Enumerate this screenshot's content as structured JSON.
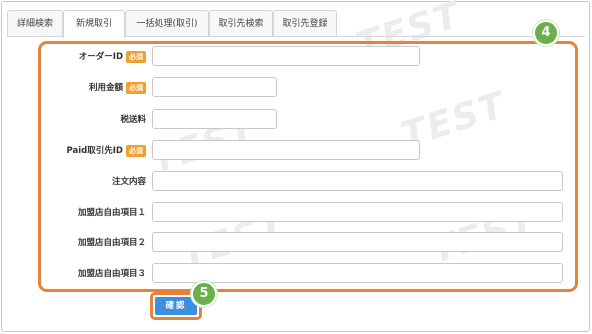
{
  "tabs": [
    {
      "label": "詳細検索"
    },
    {
      "label": "新規取引"
    },
    {
      "label": "一括処理(取引)"
    },
    {
      "label": "取引先検索"
    },
    {
      "label": "取引先登録"
    }
  ],
  "watermark": "TEST",
  "required_badge": "必須",
  "fields": [
    {
      "label": "オーダーID",
      "value": ""
    },
    {
      "label": "利用金額",
      "value": ""
    },
    {
      "label": "税送料",
      "value": ""
    },
    {
      "label": "Paid取引先ID",
      "value": ""
    },
    {
      "label": "注文内容",
      "value": ""
    },
    {
      "label": "加盟店自由項目１",
      "value": ""
    },
    {
      "label": "加盟店自由項目２",
      "value": ""
    },
    {
      "label": "加盟店自由項目３",
      "value": ""
    }
  ],
  "steps": {
    "form": "4",
    "confirm": "5"
  },
  "confirm_label": "確認",
  "colors": {
    "accent_outline": "#e8823a",
    "step_badge": "#6ab04c",
    "required_badge": "#f0a030",
    "confirm_button": "#3d8ede"
  }
}
